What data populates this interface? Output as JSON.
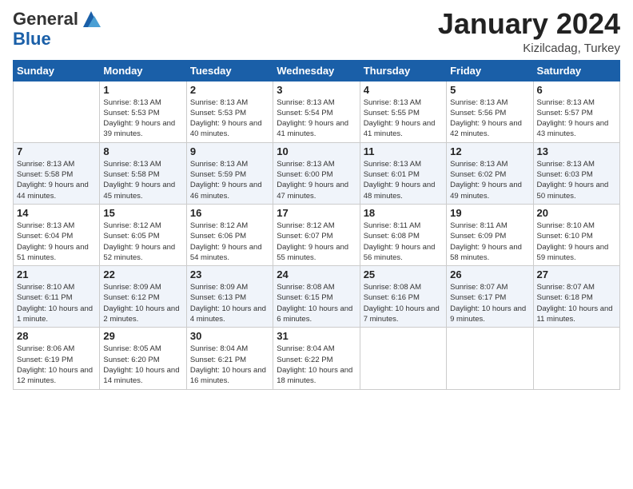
{
  "header": {
    "logo_general": "General",
    "logo_blue": "Blue",
    "month_title": "January 2024",
    "subtitle": "Kizilcadag, Turkey"
  },
  "days_of_week": [
    "Sunday",
    "Monday",
    "Tuesday",
    "Wednesday",
    "Thursday",
    "Friday",
    "Saturday"
  ],
  "weeks": [
    [
      {
        "day": "",
        "sunrise": "",
        "sunset": "",
        "daylight": "",
        "empty": true
      },
      {
        "day": "1",
        "sunrise": "Sunrise: 8:13 AM",
        "sunset": "Sunset: 5:53 PM",
        "daylight": "Daylight: 9 hours and 39 minutes."
      },
      {
        "day": "2",
        "sunrise": "Sunrise: 8:13 AM",
        "sunset": "Sunset: 5:53 PM",
        "daylight": "Daylight: 9 hours and 40 minutes."
      },
      {
        "day": "3",
        "sunrise": "Sunrise: 8:13 AM",
        "sunset": "Sunset: 5:54 PM",
        "daylight": "Daylight: 9 hours and 41 minutes."
      },
      {
        "day": "4",
        "sunrise": "Sunrise: 8:13 AM",
        "sunset": "Sunset: 5:55 PM",
        "daylight": "Daylight: 9 hours and 41 minutes."
      },
      {
        "day": "5",
        "sunrise": "Sunrise: 8:13 AM",
        "sunset": "Sunset: 5:56 PM",
        "daylight": "Daylight: 9 hours and 42 minutes."
      },
      {
        "day": "6",
        "sunrise": "Sunrise: 8:13 AM",
        "sunset": "Sunset: 5:57 PM",
        "daylight": "Daylight: 9 hours and 43 minutes."
      }
    ],
    [
      {
        "day": "7",
        "sunrise": "Sunrise: 8:13 AM",
        "sunset": "Sunset: 5:58 PM",
        "daylight": "Daylight: 9 hours and 44 minutes."
      },
      {
        "day": "8",
        "sunrise": "Sunrise: 8:13 AM",
        "sunset": "Sunset: 5:58 PM",
        "daylight": "Daylight: 9 hours and 45 minutes."
      },
      {
        "day": "9",
        "sunrise": "Sunrise: 8:13 AM",
        "sunset": "Sunset: 5:59 PM",
        "daylight": "Daylight: 9 hours and 46 minutes."
      },
      {
        "day": "10",
        "sunrise": "Sunrise: 8:13 AM",
        "sunset": "Sunset: 6:00 PM",
        "daylight": "Daylight: 9 hours and 47 minutes."
      },
      {
        "day": "11",
        "sunrise": "Sunrise: 8:13 AM",
        "sunset": "Sunset: 6:01 PM",
        "daylight": "Daylight: 9 hours and 48 minutes."
      },
      {
        "day": "12",
        "sunrise": "Sunrise: 8:13 AM",
        "sunset": "Sunset: 6:02 PM",
        "daylight": "Daylight: 9 hours and 49 minutes."
      },
      {
        "day": "13",
        "sunrise": "Sunrise: 8:13 AM",
        "sunset": "Sunset: 6:03 PM",
        "daylight": "Daylight: 9 hours and 50 minutes."
      }
    ],
    [
      {
        "day": "14",
        "sunrise": "Sunrise: 8:13 AM",
        "sunset": "Sunset: 6:04 PM",
        "daylight": "Daylight: 9 hours and 51 minutes."
      },
      {
        "day": "15",
        "sunrise": "Sunrise: 8:12 AM",
        "sunset": "Sunset: 6:05 PM",
        "daylight": "Daylight: 9 hours and 52 minutes."
      },
      {
        "day": "16",
        "sunrise": "Sunrise: 8:12 AM",
        "sunset": "Sunset: 6:06 PM",
        "daylight": "Daylight: 9 hours and 54 minutes."
      },
      {
        "day": "17",
        "sunrise": "Sunrise: 8:12 AM",
        "sunset": "Sunset: 6:07 PM",
        "daylight": "Daylight: 9 hours and 55 minutes."
      },
      {
        "day": "18",
        "sunrise": "Sunrise: 8:11 AM",
        "sunset": "Sunset: 6:08 PM",
        "daylight": "Daylight: 9 hours and 56 minutes."
      },
      {
        "day": "19",
        "sunrise": "Sunrise: 8:11 AM",
        "sunset": "Sunset: 6:09 PM",
        "daylight": "Daylight: 9 hours and 58 minutes."
      },
      {
        "day": "20",
        "sunrise": "Sunrise: 8:10 AM",
        "sunset": "Sunset: 6:10 PM",
        "daylight": "Daylight: 9 hours and 59 minutes."
      }
    ],
    [
      {
        "day": "21",
        "sunrise": "Sunrise: 8:10 AM",
        "sunset": "Sunset: 6:11 PM",
        "daylight": "Daylight: 10 hours and 1 minute."
      },
      {
        "day": "22",
        "sunrise": "Sunrise: 8:09 AM",
        "sunset": "Sunset: 6:12 PM",
        "daylight": "Daylight: 10 hours and 2 minutes."
      },
      {
        "day": "23",
        "sunrise": "Sunrise: 8:09 AM",
        "sunset": "Sunset: 6:13 PM",
        "daylight": "Daylight: 10 hours and 4 minutes."
      },
      {
        "day": "24",
        "sunrise": "Sunrise: 8:08 AM",
        "sunset": "Sunset: 6:15 PM",
        "daylight": "Daylight: 10 hours and 6 minutes."
      },
      {
        "day": "25",
        "sunrise": "Sunrise: 8:08 AM",
        "sunset": "Sunset: 6:16 PM",
        "daylight": "Daylight: 10 hours and 7 minutes."
      },
      {
        "day": "26",
        "sunrise": "Sunrise: 8:07 AM",
        "sunset": "Sunset: 6:17 PM",
        "daylight": "Daylight: 10 hours and 9 minutes."
      },
      {
        "day": "27",
        "sunrise": "Sunrise: 8:07 AM",
        "sunset": "Sunset: 6:18 PM",
        "daylight": "Daylight: 10 hours and 11 minutes."
      }
    ],
    [
      {
        "day": "28",
        "sunrise": "Sunrise: 8:06 AM",
        "sunset": "Sunset: 6:19 PM",
        "daylight": "Daylight: 10 hours and 12 minutes."
      },
      {
        "day": "29",
        "sunrise": "Sunrise: 8:05 AM",
        "sunset": "Sunset: 6:20 PM",
        "daylight": "Daylight: 10 hours and 14 minutes."
      },
      {
        "day": "30",
        "sunrise": "Sunrise: 8:04 AM",
        "sunset": "Sunset: 6:21 PM",
        "daylight": "Daylight: 10 hours and 16 minutes."
      },
      {
        "day": "31",
        "sunrise": "Sunrise: 8:04 AM",
        "sunset": "Sunset: 6:22 PM",
        "daylight": "Daylight: 10 hours and 18 minutes."
      },
      {
        "day": "",
        "sunrise": "",
        "sunset": "",
        "daylight": "",
        "empty": true
      },
      {
        "day": "",
        "sunrise": "",
        "sunset": "",
        "daylight": "",
        "empty": true
      },
      {
        "day": "",
        "sunrise": "",
        "sunset": "",
        "daylight": "",
        "empty": true
      }
    ]
  ]
}
